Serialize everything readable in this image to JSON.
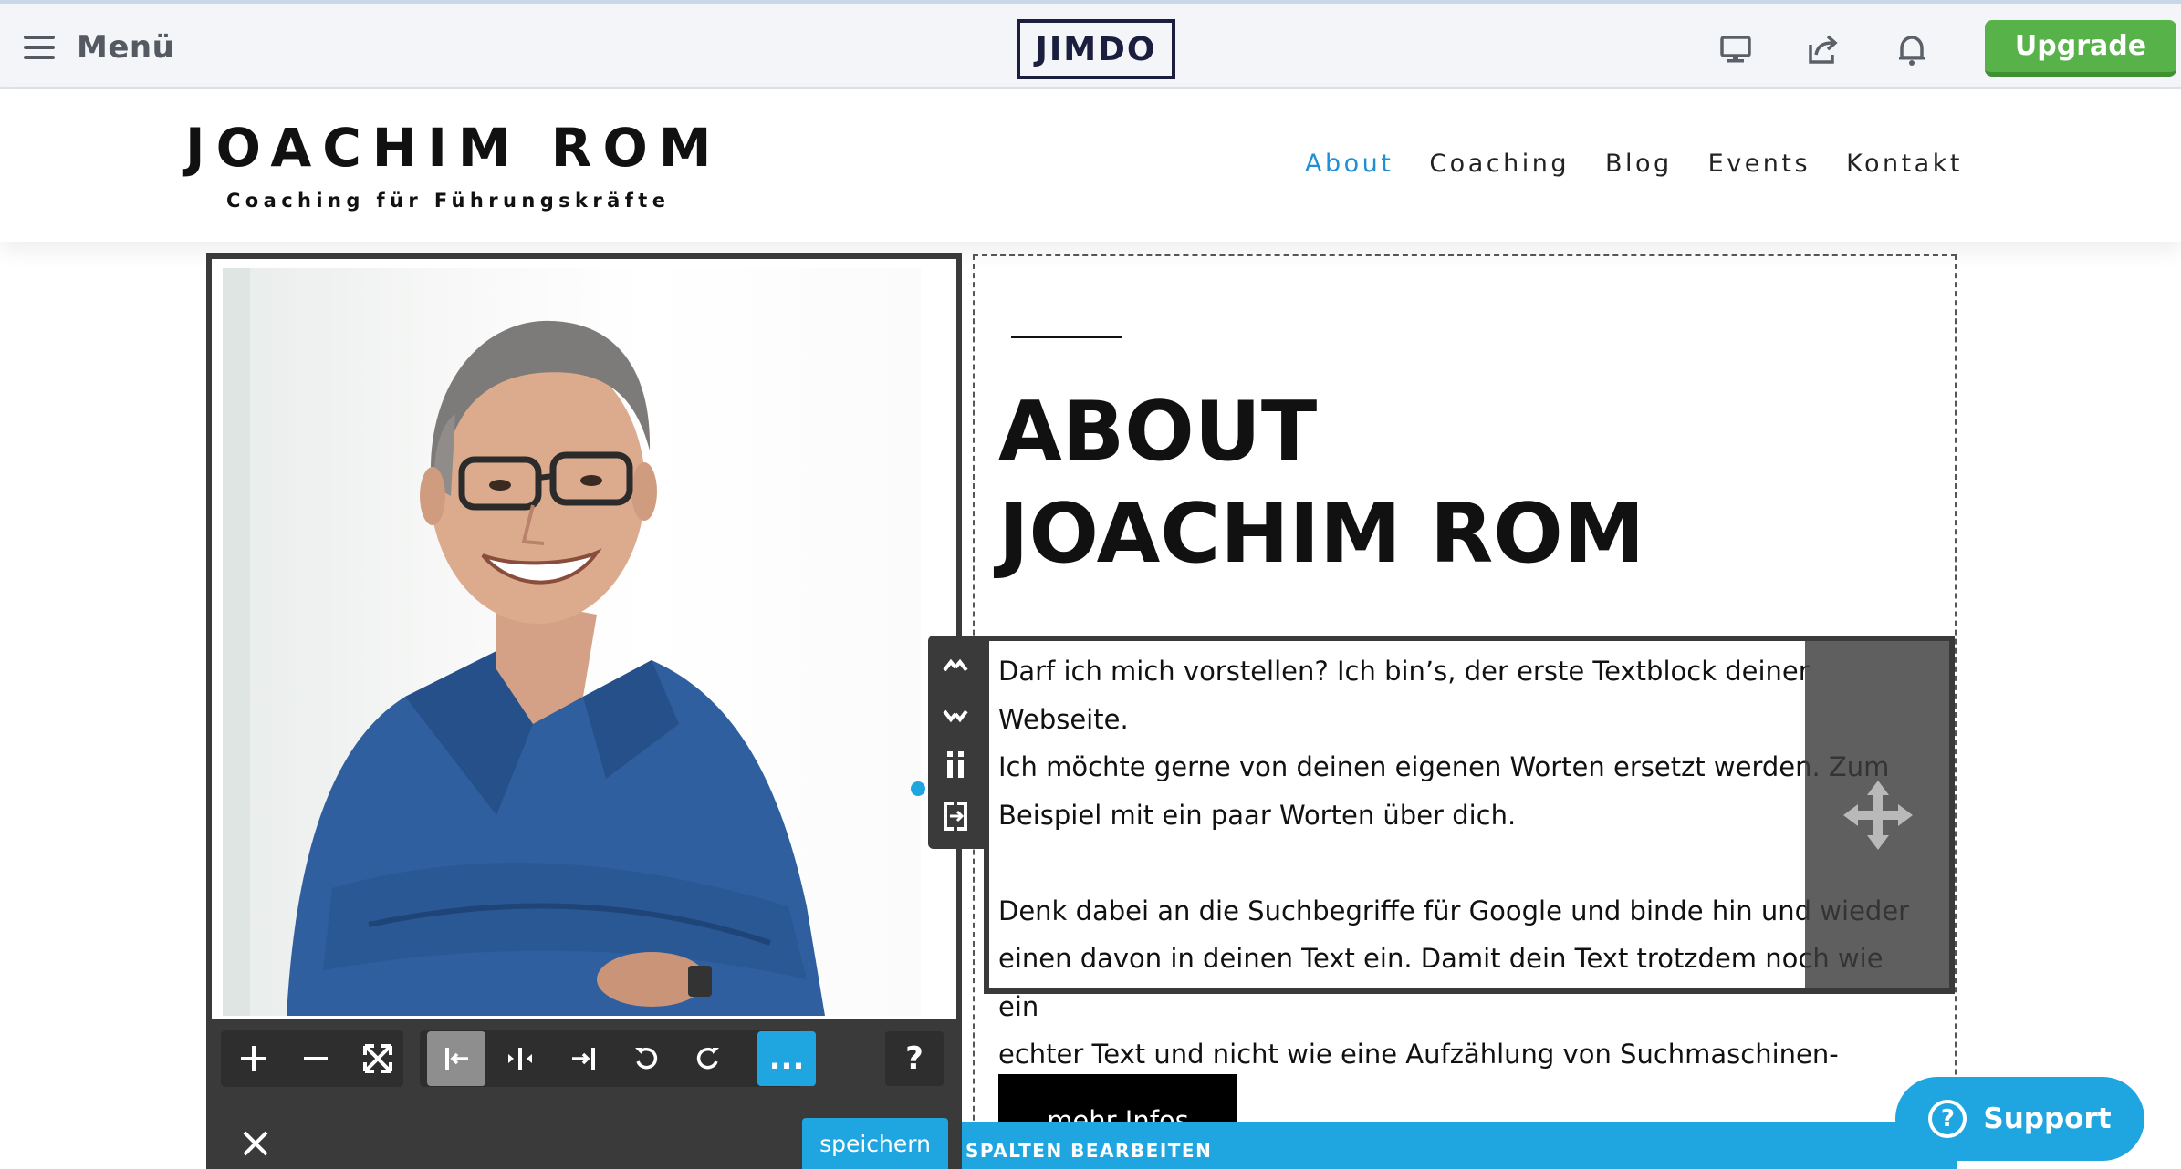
{
  "editor": {
    "menu_label": "Menü",
    "logo_text": "JIMDO",
    "upgrade_label": "Upgrade",
    "icons": [
      "monitor-icon",
      "share-icon",
      "bell-icon"
    ]
  },
  "site": {
    "title": "JOACHIM ROM",
    "subtitle": "Coaching für Führungskräfte",
    "nav": [
      {
        "label": "About",
        "active": true
      },
      {
        "label": "Coaching",
        "active": false
      },
      {
        "label": "Blog",
        "active": false
      },
      {
        "label": "Events",
        "active": false
      },
      {
        "label": "Kontakt",
        "active": false
      }
    ],
    "active_color": "#1f8fd6"
  },
  "content": {
    "heading_line1": "ABOUT",
    "heading_line2": "JOACHIM ROM",
    "paragraph1_lines": [
      "Darf ich mich vorstellen? Ich bin’s, der erste Textblock deiner Webseite.",
      "Ich möchte gerne von deinen eigenen Worten ersetzt werden. Zum",
      "Beispiel mit ein paar Worten über dich."
    ],
    "paragraph2_lines": [
      "Denk dabei an die Suchbegriffe für Google und binde hin und wieder",
      "einen davon in deinen Text ein. Damit dein Text trotzdem noch wie ein",
      "echter Text und nicht wie eine Aufzählung von Suchmaschinen-Begriffen."
    ],
    "button_label": "mehr Infos"
  },
  "image_toolbar": {
    "more_label": "...",
    "help_label": "?",
    "save_label": "speichern"
  },
  "spalten_label": "SPALTEN BEARBEITEN",
  "support_label": "Support",
  "colors": {
    "accent_blue": "#1fa6e0",
    "upgrade_green": "#58b24a",
    "toolbar_dark": "#3a3a3a"
  }
}
